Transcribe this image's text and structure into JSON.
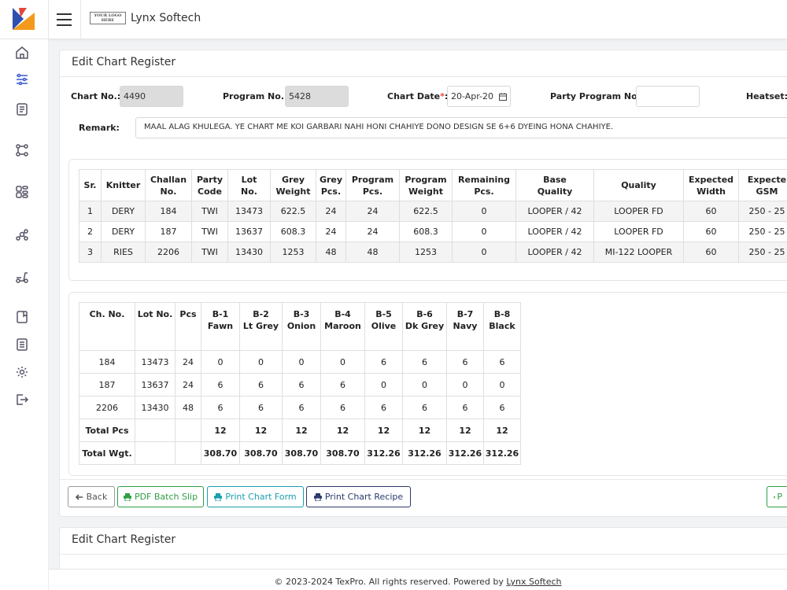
{
  "brand": {
    "logo_text": "YOUR LOGO HERE",
    "name": "Lynx Softech"
  },
  "sidebar": {
    "icons": [
      "home-icon",
      "sliders-icon",
      "clipboard-icon",
      "nodes-icon",
      "grid-icon",
      "network-icon",
      "scooter-icon",
      "book-icon",
      "document-icon",
      "gear-icon",
      "logout-icon"
    ]
  },
  "form": {
    "title": "Edit Chart Register",
    "chart_no_label": "Chart No.:",
    "chart_no_value": "4490",
    "program_no_label": "Program No.:",
    "program_no_value": "5428",
    "chart_date_label": "Chart Date",
    "chart_date_required": "*",
    "chart_date_colon": ":",
    "chart_date_value": "20-Apr-20",
    "party_program_label": "Party Program No:",
    "party_program_value": "",
    "heatset_label": "Heatset:",
    "remark_label": "Remark:",
    "remark_value": "MAAL ALAG KHULEGA. YE CHART ME KOI GARBARI NAHI HONI CHAHIYE DONO DESIGN SE 6+6 DYEING HONA CHAHIYE."
  },
  "program_table": {
    "headers": [
      [
        "Sr."
      ],
      [
        "Knitter"
      ],
      [
        "Challan",
        "No."
      ],
      [
        "Party",
        "Code"
      ],
      [
        "Lot",
        "No."
      ],
      [
        "Grey",
        "Weight"
      ],
      [
        "Grey",
        "Pcs."
      ],
      [
        "Program",
        "Pcs."
      ],
      [
        "Program",
        "Weight"
      ],
      [
        "Remaining",
        "Pcs."
      ],
      [
        "Base",
        "Quality"
      ],
      [
        "Quality"
      ],
      [
        "Expected",
        "Width"
      ],
      [
        "Expecte",
        "GSM"
      ]
    ],
    "rows": [
      [
        "1",
        "DERY",
        "184",
        "TWI",
        "13473",
        "622.5",
        "24",
        "24",
        "622.5",
        "0",
        "LOOPER / 42",
        "LOOPER FD",
        "60",
        "250 - 25"
      ],
      [
        "2",
        "DERY",
        "187",
        "TWI",
        "13637",
        "608.3",
        "24",
        "24",
        "608.3",
        "0",
        "LOOPER / 42",
        "LOOPER FD",
        "60",
        "250 - 25"
      ],
      [
        "3",
        "RIES",
        "2206",
        "TWI",
        "13430",
        "1253",
        "48",
        "48",
        "1253",
        "0",
        "LOOPER / 42",
        "MI-122 LOOPER",
        "60",
        "250 - 25"
      ]
    ]
  },
  "batch_table": {
    "headers": [
      [
        "Ch. No."
      ],
      [
        "Lot No."
      ],
      [
        "Pcs"
      ],
      [
        "B-1",
        "Fawn"
      ],
      [
        "B-2",
        "Lt Grey"
      ],
      [
        "B-3",
        "Onion"
      ],
      [
        "B-4",
        "Maroon"
      ],
      [
        "B-5",
        "Olive"
      ],
      [
        "B-6",
        "Dk Grey"
      ],
      [
        "B-7",
        "Navy"
      ],
      [
        "B-8",
        "Black"
      ]
    ],
    "rows": [
      [
        "184",
        "13473",
        "24",
        "0",
        "0",
        "0",
        "0",
        "6",
        "6",
        "6",
        "6"
      ],
      [
        "187",
        "13637",
        "24",
        "6",
        "6",
        "6",
        "6",
        "0",
        "0",
        "0",
        "0"
      ],
      [
        "2206",
        "13430",
        "48",
        "6",
        "6",
        "6",
        "6",
        "6",
        "6",
        "6",
        "6"
      ]
    ],
    "totals": [
      [
        "Total Pcs",
        "12",
        "12",
        "12",
        "12",
        "12",
        "12",
        "12",
        "12"
      ],
      [
        "Total Wgt.",
        "308.70",
        "308.70",
        "308.70",
        "308.70",
        "312.26",
        "312.26",
        "312.26",
        "312.26"
      ]
    ]
  },
  "buttons": {
    "back": "Back",
    "pdf_batch_slip": "PDF Batch Slip",
    "print_chart_form": "Print Chart Form",
    "print_chart_recipe": "Print Chart Recipe",
    "print_partial": "P"
  },
  "second_card": {
    "title": "Edit Chart Register"
  },
  "footer": {
    "text": "© 2023-2024 TexPro. All rights reserved. Powered by ",
    "link": "Lynx Softech"
  },
  "colors": {
    "green": "#2f9e44",
    "teal": "#1a9fae",
    "navy": "#2a3a6d",
    "gray": "#555555"
  }
}
